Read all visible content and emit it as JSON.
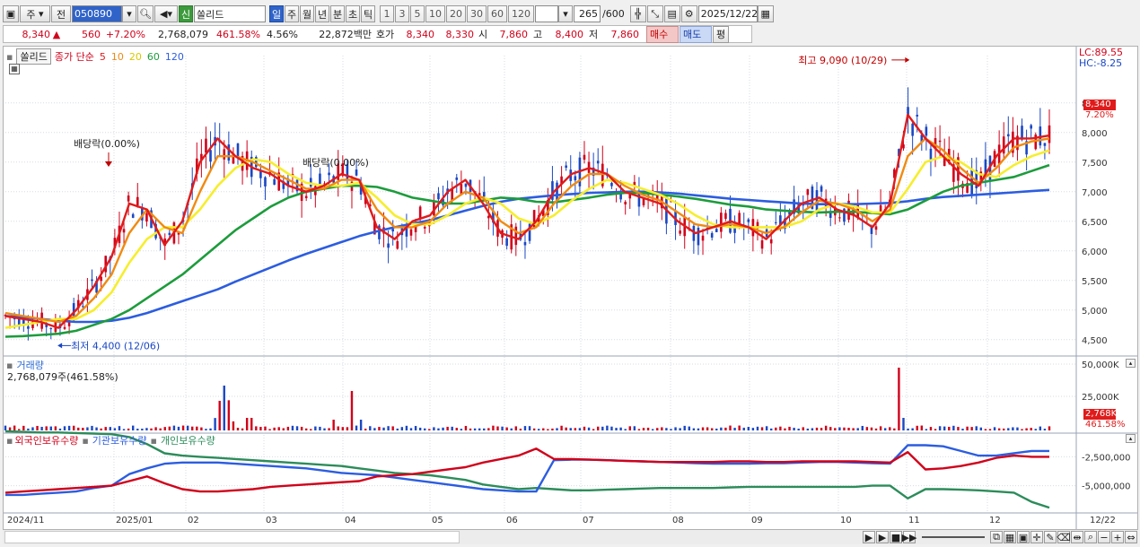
{
  "toolbar": {
    "market_btn": "주",
    "prev_btn": "전",
    "code_value": "050890",
    "stock_type_badge": "신",
    "stock_name": "쏠리드",
    "periods": [
      "일",
      "주",
      "월",
      "년",
      "분",
      "초",
      "틱"
    ],
    "active_period": "일",
    "minute_nums": [
      "1",
      "3",
      "5",
      "10",
      "20",
      "30",
      "60",
      "120"
    ],
    "count_value": "265",
    "count_total": "/600",
    "date_value": "2025/12/22"
  },
  "pricebar": {
    "price": "8,340",
    "arrow": "▲",
    "change": "560",
    "change_pct": "+7.20%",
    "volume": "2,768,079",
    "volume_pct": "461.58%",
    "turnover": "4.56%",
    "amount": "22,872백만",
    "hoga_label": "호가",
    "ask": "8,340",
    "bid": "8,330",
    "open_label": "시",
    "open": "7,860",
    "high_label": "고",
    "high": "8,400",
    "low_label": "저",
    "low": "7,860",
    "buy_btn": "매수",
    "sell_btn": "매도",
    "eval_btn": "평"
  },
  "panels": {
    "price_legend": {
      "name": "쏠리드",
      "ma_label": "종가 단순",
      "ma_periods": [
        "5",
        "10",
        "20",
        "60",
        "120"
      ]
    },
    "volume_title": "거래량",
    "volume_value": "2,768,079주(461.58%)",
    "holdings_legend": [
      "외국인보유수량",
      "기관보유수량",
      "개인보유수량"
    ],
    "lc_label": "LC:89.55",
    "hc_label": "HC:-8.25",
    "price_tag": "8,340",
    "price_tag_pct": "7.20%",
    "vol_tag": "2,768K",
    "vol_tag_pct": "461.58%"
  },
  "colors": {
    "up": "#d0021b",
    "down": "#1a47c4",
    "ma5": "#e01b1b",
    "ma10": "#f08a12",
    "ma20": "#f6ee2c",
    "ma60": "#1c9c3c",
    "ma120": "#2c5de0",
    "foreign": "#d0021b",
    "institution": "#2c5de0",
    "individual": "#2c8c5a"
  },
  "chart_data": {
    "type": "candlestick",
    "price_ticks": [
      "8,500",
      "8,000",
      "7,500",
      "7,000",
      "6,500",
      "6,000",
      "5,500",
      "5,000",
      "4,500"
    ],
    "price_tick_values": [
      8500,
      8000,
      7500,
      7000,
      6500,
      6000,
      5500,
      5000,
      4500
    ],
    "price_ylim": [
      4300,
      9300
    ],
    "volume_ticks": [
      "50,000K",
      "25,000K"
    ],
    "holdings_ticks": [
      "-2,500,000",
      "-5,000,000"
    ],
    "x_labels": [
      "2024/11",
      "2025/01",
      "02",
      "03",
      "04",
      "05",
      "06",
      "07",
      "08",
      "09",
      "10",
      "11",
      "12",
      "12/22"
    ],
    "annotations": {
      "high_label": "최고 9,090 (10/29)",
      "high_value": 9090,
      "low_label": "최저 4,400 (12/06)",
      "low_value": 4400,
      "dividend_labels": [
        "배당락(0.00%)",
        "배당락(0.00%)"
      ]
    },
    "last_price": 8340,
    "ma_series": {
      "ma5": [
        4900,
        4850,
        4800,
        4700,
        5000,
        5400,
        5900,
        6800,
        6700,
        6100,
        6500,
        7500,
        7900,
        7600,
        7400,
        7300,
        7100,
        7000,
        7100,
        7300,
        7200,
        6400,
        6200,
        6500,
        6600,
        7000,
        7200,
        6800,
        6300,
        6200,
        6500,
        7000,
        7300,
        7400,
        7300,
        7000,
        6900,
        6800,
        6500,
        6300,
        6400,
        6500,
        6400,
        6200,
        6500,
        6800,
        6900,
        6700,
        6600,
        6400,
        6800,
        8300,
        7900,
        7600,
        7300,
        7100,
        7600,
        7900,
        7900,
        7950
      ],
      "ma10": [
        4950,
        4900,
        4850,
        4800,
        4900,
        5200,
        5600,
        6300,
        6700,
        6400,
        6300,
        7000,
        7600,
        7600,
        7500,
        7350,
        7200,
        7050,
        7050,
        7200,
        7200,
        6700,
        6400,
        6400,
        6500,
        6800,
        7000,
        6900,
        6500,
        6300,
        6400,
        6800,
        7100,
        7300,
        7300,
        7100,
        6950,
        6850,
        6650,
        6450,
        6400,
        6450,
        6400,
        6300,
        6400,
        6650,
        6850,
        6800,
        6700,
        6500,
        6700,
        7600,
        7900,
        7700,
        7400,
        7150,
        7400,
        7750,
        7850,
        7900
      ],
      "ma20": [
        4700,
        4750,
        4800,
        4850,
        4850,
        5000,
        5300,
        5800,
        6200,
        6400,
        6400,
        6700,
        7100,
        7400,
        7550,
        7500,
        7300,
        7150,
        7100,
        7100,
        7150,
        6900,
        6600,
        6450,
        6450,
        6600,
        6800,
        6900,
        6800,
        6550,
        6450,
        6600,
        6850,
        7050,
        7200,
        7150,
        7050,
        6950,
        6800,
        6600,
        6450,
        6400,
        6400,
        6400,
        6400,
        6500,
        6700,
        6800,
        6750,
        6650,
        6650,
        7050,
        7500,
        7600,
        7500,
        7300,
        7250,
        7450,
        7600,
        7700
      ],
      "ma60": [
        4550,
        4560,
        4580,
        4600,
        4650,
        4750,
        4850,
        5000,
        5200,
        5400,
        5600,
        5850,
        6100,
        6350,
        6550,
        6750,
        6900,
        7000,
        7050,
        7100,
        7100,
        7080,
        7000,
        6900,
        6850,
        6800,
        6800,
        6850,
        6900,
        6880,
        6830,
        6820,
        6860,
        6900,
        6950,
        6980,
        6980,
        6950,
        6920,
        6880,
        6830,
        6780,
        6750,
        6700,
        6680,
        6660,
        6650,
        6660,
        6660,
        6640,
        6620,
        6700,
        6850,
        7000,
        7100,
        7150,
        7200,
        7250,
        7350,
        7450
      ],
      "ma120": [
        4900,
        4880,
        4850,
        4820,
        4800,
        4800,
        4820,
        4870,
        4950,
        5050,
        5150,
        5250,
        5350,
        5480,
        5600,
        5720,
        5840,
        5950,
        6050,
        6150,
        6250,
        6330,
        6400,
        6460,
        6520,
        6600,
        6680,
        6760,
        6830,
        6880,
        6910,
        6940,
        6960,
        6980,
        6990,
        7000,
        7000,
        6990,
        6970,
        6940,
        6910,
        6880,
        6860,
        6840,
        6820,
        6800,
        6790,
        6790,
        6790,
        6800,
        6810,
        6840,
        6880,
        6910,
        6930,
        6950,
        6970,
        6990,
        7010,
        7030
      ]
    },
    "holdings_series": {
      "foreign": [
        -5.6,
        -5.5,
        -5.4,
        -5.3,
        -5.2,
        -5.1,
        -5.0,
        -4.6,
        -4.2,
        -4.8,
        -5.3,
        -5.5,
        -5.5,
        -5.4,
        -5.3,
        -5.1,
        -5.0,
        -4.9,
        -4.8,
        -4.7,
        -4.6,
        -4.2,
        -4.1,
        -4.0,
        -3.8,
        -3.6,
        -3.4,
        -3.0,
        -2.7,
        -2.4,
        -1.8,
        -2.7,
        -2.7,
        -2.75,
        -2.8,
        -2.85,
        -2.9,
        -2.95,
        -2.95,
        -2.95,
        -2.95,
        -2.9,
        -2.9,
        -2.95,
        -2.95,
        -2.9,
        -2.9,
        -2.9,
        -2.9,
        -2.95,
        -3.0,
        -2.1,
        -3.6,
        -3.5,
        -3.3,
        -3.0,
        -2.6,
        -2.4,
        -2.5,
        -2.5
      ],
      "institution": [
        -5.8,
        -5.8,
        -5.7,
        -5.6,
        -5.5,
        -5.2,
        -5.0,
        -4.0,
        -3.5,
        -3.1,
        -3.0,
        -3.0,
        -3.0,
        -3.1,
        -3.2,
        -3.3,
        -3.4,
        -3.5,
        -3.7,
        -3.9,
        -4.0,
        -4.1,
        -4.3,
        -4.5,
        -4.7,
        -4.9,
        -5.1,
        -5.3,
        -5.4,
        -5.5,
        -5.5,
        -2.8,
        -2.75,
        -2.75,
        -2.8,
        -2.85,
        -2.9,
        -2.95,
        -3.0,
        -3.05,
        -3.1,
        -3.1,
        -3.1,
        -3.05,
        -3.05,
        -3.0,
        -2.95,
        -2.95,
        -3.0,
        -3.05,
        -3.1,
        -1.5,
        -1.5,
        -1.6,
        -2.0,
        -2.4,
        -2.4,
        -2.2,
        -2.0,
        -2.0
      ],
      "individual": [
        -0.3,
        -0.35,
        -0.4,
        -0.4,
        -0.45,
        -0.5,
        -0.55,
        -0.8,
        -1.4,
        -2.2,
        -2.4,
        -2.5,
        -2.6,
        -2.7,
        -2.8,
        -2.9,
        -3.0,
        -3.1,
        -3.2,
        -3.3,
        -3.5,
        -3.7,
        -3.9,
        -4.0,
        -4.1,
        -4.3,
        -4.5,
        -4.9,
        -5.1,
        -5.3,
        -5.2,
        -5.3,
        -5.4,
        -5.4,
        -5.35,
        -5.3,
        -5.25,
        -5.2,
        -5.2,
        -5.2,
        -5.2,
        -5.15,
        -5.1,
        -5.1,
        -5.1,
        -5.1,
        -5.1,
        -5.1,
        -5.1,
        -5.0,
        -5.0,
        -6.1,
        -5.3,
        -5.3,
        -5.35,
        -5.4,
        -5.5,
        -5.6,
        -6.4,
        -6.9
      ]
    }
  }
}
